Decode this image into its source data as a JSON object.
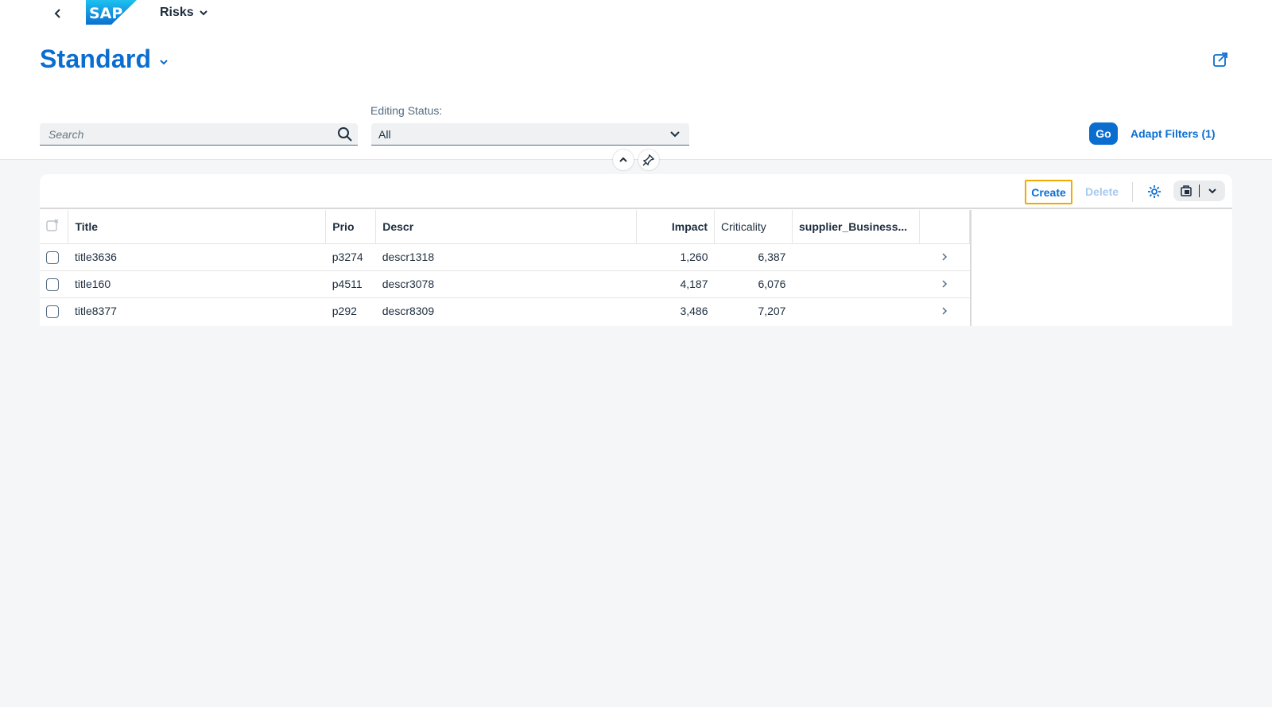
{
  "shell": {
    "app_title": "Risks"
  },
  "variant": {
    "title": "Standard"
  },
  "filterbar": {
    "search_placeholder": "Search",
    "editing_status_label": "Editing Status:",
    "editing_status_value": "All",
    "go_label": "Go",
    "adapt_label": "Adapt Filters (1)"
  },
  "toolbar": {
    "create_label": "Create",
    "delete_label": "Delete"
  },
  "table": {
    "columns": [
      "Title",
      "Prio",
      "Descr",
      "Impact",
      "Criticality",
      "supplier_Business..."
    ],
    "rows": [
      {
        "title": "title3636",
        "prio": "p3274",
        "descr": "descr1318",
        "impact": "1,260",
        "criticality": "6,387",
        "supplier": ""
      },
      {
        "title": "title160",
        "prio": "p4511",
        "descr": "descr3078",
        "impact": "4,187",
        "criticality": "6,076",
        "supplier": ""
      },
      {
        "title": "title8377",
        "prio": "p292",
        "descr": "descr8309",
        "impact": "3,486",
        "criticality": "7,207",
        "supplier": ""
      }
    ]
  },
  "colors": {
    "brand": "#0a6ed1",
    "focus": "#f0ab00"
  },
  "icons": [
    "back-arrow-icon",
    "sap-logo",
    "chevron-down-icon",
    "share-icon",
    "search-icon",
    "collapse-icon",
    "pin-icon",
    "settings-icon",
    "export-icon",
    "row-navigation-icon"
  ]
}
